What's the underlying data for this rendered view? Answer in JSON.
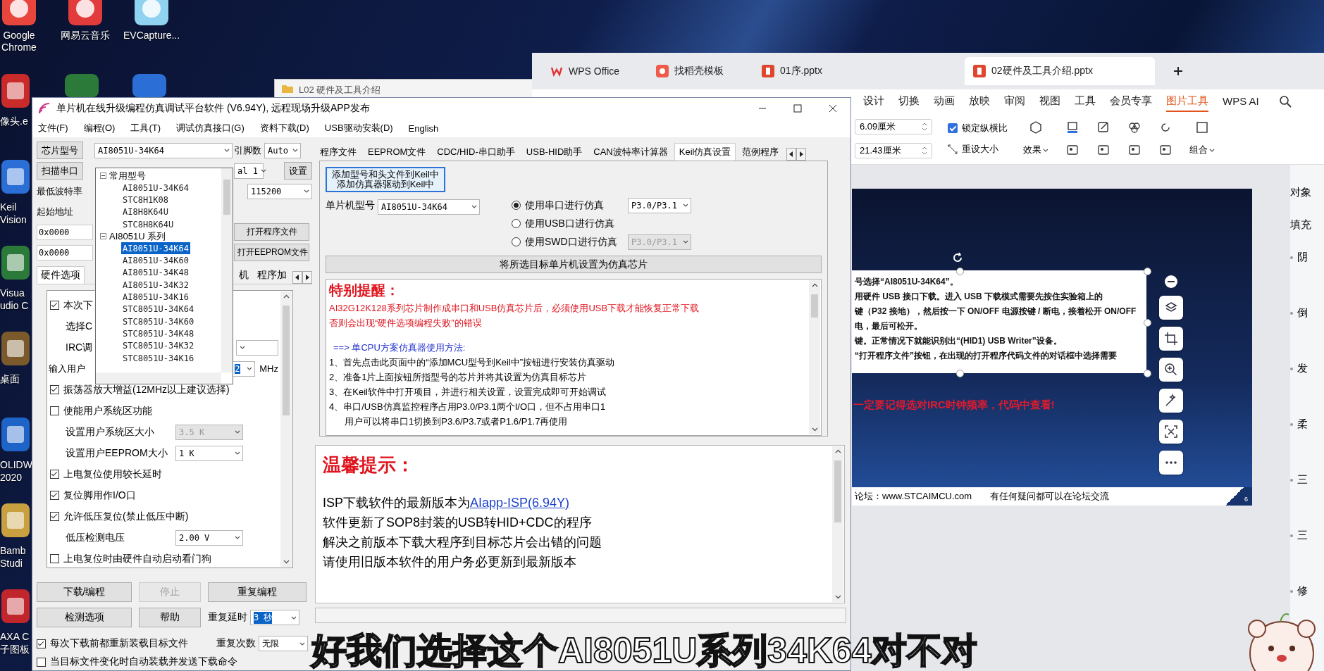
{
  "desktop": {
    "top_icons": [
      {
        "label": "Google Chrome"
      },
      {
        "label": "网易云音乐"
      },
      {
        "label": "EVCapture..."
      }
    ],
    "side_icons": [
      {
        "lines": [
          "像头.e"
        ]
      },
      {
        "lines": [
          "Keil",
          "Vision"
        ]
      },
      {
        "lines": [
          "Visua",
          "udio C"
        ]
      },
      {
        "lines": [
          "桌面"
        ]
      },
      {
        "lines": [
          "OLIDW",
          "2020"
        ]
      },
      {
        "lines": [
          "Bamb",
          "Studi"
        ]
      },
      {
        "lines": [
          "AXA C",
          "子图板"
        ]
      }
    ]
  },
  "folder_window": {
    "title": "L02 硬件及工具介绍"
  },
  "wps_window": {
    "tabs": [
      {
        "label": "WPS Office",
        "selected": false
      },
      {
        "label": "找稻壳模板",
        "selected": false
      },
      {
        "label": "01序.pptx",
        "selected": false
      },
      {
        "label": "02硬件及工具介绍.pptx",
        "selected": true
      }
    ],
    "ribbon": [
      {
        "label": "设计",
        "selected": false
      },
      {
        "label": "切换",
        "selected": false
      },
      {
        "label": "动画",
        "selected": false
      },
      {
        "label": "放映",
        "selected": false
      },
      {
        "label": "审阅",
        "selected": false
      },
      {
        "label": "视图",
        "selected": false
      },
      {
        "label": "工具",
        "selected": false
      },
      {
        "label": "会员专享",
        "selected": false
      },
      {
        "label": "图片工具",
        "selected": true
      },
      {
        "label": "WPS AI",
        "selected": false
      }
    ],
    "toolbar": {
      "height": "6.09厘米",
      "width": "21.43厘米",
      "lock_ratio": {
        "label": "锁定纵横比",
        "checked": true
      },
      "reset": "重设大小",
      "effects": "效果",
      "group": "组合"
    },
    "slide": {
      "lines": [
        "号选择“AI8051U-34K64”。",
        "用硬件 USB 接口下载。进入 USB 下载模式需要先按住实验箱上的",
        "键（P32 接地），然后按一下 ON/OFF 电源按键 / 断电，接着松开 ON/OFF",
        "电，最后可松开。",
        "键。正常情况下就能识别出“(HID1) USB Writer”设备。",
        "“打开程序文件”按钮，在出现的打开程序代码文件的对话框中选择需要"
      ],
      "red_note": "一定要记得选对IRC时钟频率，代码中查看!",
      "footer_site": "论坛：www.STCAIMCU.com",
      "footer_note": "有任何疑问都可以在论坛交流",
      "page": "6"
    },
    "side_panel": {
      "title": "对象",
      "fill": "填充",
      "items": [
        "阴",
        "倒",
        "发",
        "柔",
        "三",
        "三",
        "修"
      ]
    }
  },
  "isp_window": {
    "title": "单片机在线升级编程仿真调试平台软件 (V6.94Y), 远程现场升级APP发布",
    "menu": [
      "文件(F)",
      "编程(O)",
      "工具(T)",
      "调试仿真接口(G)",
      "资料下载(D)",
      "USB驱动安装(D)",
      "English"
    ],
    "left": {
      "chip_button": "芯片型号",
      "chip_select": "AI8051U-34K64",
      "pins_label": "引脚数",
      "pins_select": "Auto",
      "scan_button": "扫描串口",
      "port_select": "al 1",
      "settings_button": "设置",
      "baud_label": "最低波特率",
      "baud_select": "115200",
      "address_label": "起始地址",
      "address_rows": [
        {
          "value": "0x0000",
          "button": "打开程序文件"
        },
        {
          "value": "0x0000",
          "button": "打开EEPROM文件"
        }
      ],
      "tabs": [
        {
          "label": "硬件选项",
          "selected": true
        },
        {
          "label": "机",
          "selected": false
        },
        {
          "label": "程序加",
          "selected": false
        }
      ],
      "options": [
        {
          "kind": "check",
          "label": "本次下",
          "checked": true
        },
        {
          "kind": "text",
          "label": "选择C"
        },
        {
          "kind": "partial-select",
          "label": "IRC调"
        },
        {
          "kind": "partial-select",
          "label": "输入用户",
          "value": "2",
          "unit": "MHz"
        },
        {
          "kind": "check",
          "label": "振荡器放大增益(12MHz以上建议选择)",
          "checked": true
        },
        {
          "kind": "check",
          "label": "使能用户系统区功能",
          "checked": false
        },
        {
          "kind": "select",
          "label": "设置用户系统区大小",
          "value": "3.5 K",
          "disabled": true
        },
        {
          "kind": "select",
          "label": "设置用户EEPROM大小",
          "value": "1 K",
          "disabled": false
        },
        {
          "kind": "check",
          "label": "上电复位使用较长延时",
          "checked": true
        },
        {
          "kind": "check",
          "label": "复位脚用作I/O口",
          "checked": true
        },
        {
          "kind": "check",
          "label": "允许低压复位(禁止低压中断)",
          "checked": true
        },
        {
          "kind": "select",
          "label": "低压检测电压",
          "value": "2.00 V",
          "disabled": false
        },
        {
          "kind": "check",
          "label": "上电复位时由硬件自动启动看门狗",
          "checked": false
        }
      ],
      "buttons": [
        {
          "label": "下载/编程",
          "disabled": false
        },
        {
          "label": "停止",
          "disabled": true
        },
        {
          "label": "重复编程",
          "disabled": false
        },
        {
          "label": "检测选项",
          "disabled": false
        },
        {
          "label": "帮助",
          "disabled": false
        }
      ],
      "repeat_delay": {
        "label": "重复延时",
        "value": "3 秒"
      },
      "repeat_count": {
        "label": "重复次数",
        "value": "无限"
      },
      "bottom_checks": [
        {
          "label": "每次下载前都重新装载目标文件",
          "checked": true
        },
        {
          "label": "当目标文件变化时自动装载并发送下载命令",
          "checked": false
        }
      ]
    },
    "chip_dropdown": {
      "groups": [
        {
          "label": "常用型号",
          "expanded": true,
          "children": [
            {
              "label": "AI8051U-34K64",
              "selected": false
            },
            {
              "label": "STC8H1K08",
              "selected": false
            },
            {
              "label": "AI8H8K64U",
              "selected": false
            },
            {
              "label": "STC8H8K64U",
              "selected": false
            }
          ]
        },
        {
          "label": "AI8051U 系列",
          "expanded": true,
          "children": [
            {
              "label": "AI8051U-34K64",
              "selected": true
            },
            {
              "label": "AI8051U-34K60",
              "selected": false
            },
            {
              "label": "AI8051U-34K48",
              "selected": false
            },
            {
              "label": "AI8051U-34K32",
              "selected": false
            },
            {
              "label": "AI8051U-34K16",
              "selected": false
            },
            {
              "label": "STC8051U-34K64",
              "selected": false
            },
            {
              "label": "STC8051U-34K60",
              "selected": false
            },
            {
              "label": "STC8051U-34K48",
              "selected": false
            },
            {
              "label": "STC8051U-34K32",
              "selected": false
            },
            {
              "label": "STC8051U-34K16",
              "selected": false
            }
          ]
        }
      ]
    },
    "right": {
      "tabs": [
        {
          "label": "程序文件",
          "selected": false
        },
        {
          "label": "EEPROM文件",
          "selected": false
        },
        {
          "label": "CDC/HID-串口助手",
          "selected": false
        },
        {
          "label": "USB-HID助手",
          "selected": false
        },
        {
          "label": "CAN波特率计算器",
          "selected": false
        },
        {
          "label": "Keil仿真设置",
          "selected": true
        },
        {
          "label": "范例程序",
          "selected": false
        }
      ],
      "keil": {
        "add_button": [
          "添加型号和头文件到Keil中",
          "添加仿真器驱动到Keil中"
        ],
        "model_label": "单片机型号",
        "model_select": "AI8051U-34K64",
        "modes": [
          {
            "label": "使用串口进行仿真",
            "selected": true,
            "port": "P3.0/P3.1",
            "port_disabled": false
          },
          {
            "label": "使用USB口进行仿真",
            "selected": false
          },
          {
            "label": "使用SWD口进行仿真",
            "selected": false,
            "port": "P3.0/P3.1",
            "port_disabled": true
          }
        ],
        "set_button": "将所选目标单片机设置为仿真芯片",
        "notes": [
          {
            "kind": "heading",
            "text": "特别提醒："
          },
          {
            "kind": "warning",
            "text": "AI32G12K128系列芯片制作成串口和USB仿真芯片后，必须使用USB下载才能恢复正常下载"
          },
          {
            "kind": "warning",
            "text": "否则会出现“硬件选项编程失败”的错误"
          },
          {
            "kind": "section",
            "text": "==> 单CPU方案仿真器使用方法:"
          },
          {
            "kind": "line",
            "text": "1、首先点击此页面中的“添加MCU型号到Keil中”按钮进行安装仿真驱动"
          },
          {
            "kind": "line",
            "text": "2、准备1片上面按钮所指型号的芯片并将其设置为仿真目标芯片"
          },
          {
            "kind": "line",
            "text": "3、在Keil软件中打开项目，并进行相关设置，设置完成即可开始调试"
          },
          {
            "kind": "line",
            "text": "4、串口/USB仿真监控程序占用P3.0/P3.1两个I/O口，但不占用串口1"
          },
          {
            "kind": "indent",
            "text": "用户可以将串口1切换到P3.6/P3.7或者P1.6/P1.7再使用"
          }
        ]
      },
      "tips": {
        "heading": "温馨提示：",
        "lines": [
          {
            "text": "ISP下载软件的最新版本为",
            "link": "AIapp-ISP(6.94Y)"
          },
          {
            "text": "软件更新了SOP8封装的USB转HID+CDC的程序"
          },
          {
            "text": "解决之前版本下载大程序到目标芯片会出错的问题"
          },
          {
            "text": "请使用旧版本软件的用户务必更新到最新版本"
          }
        ]
      }
    }
  },
  "subtitle": "好我们选择这个AI8051U系列34K64对不对"
}
